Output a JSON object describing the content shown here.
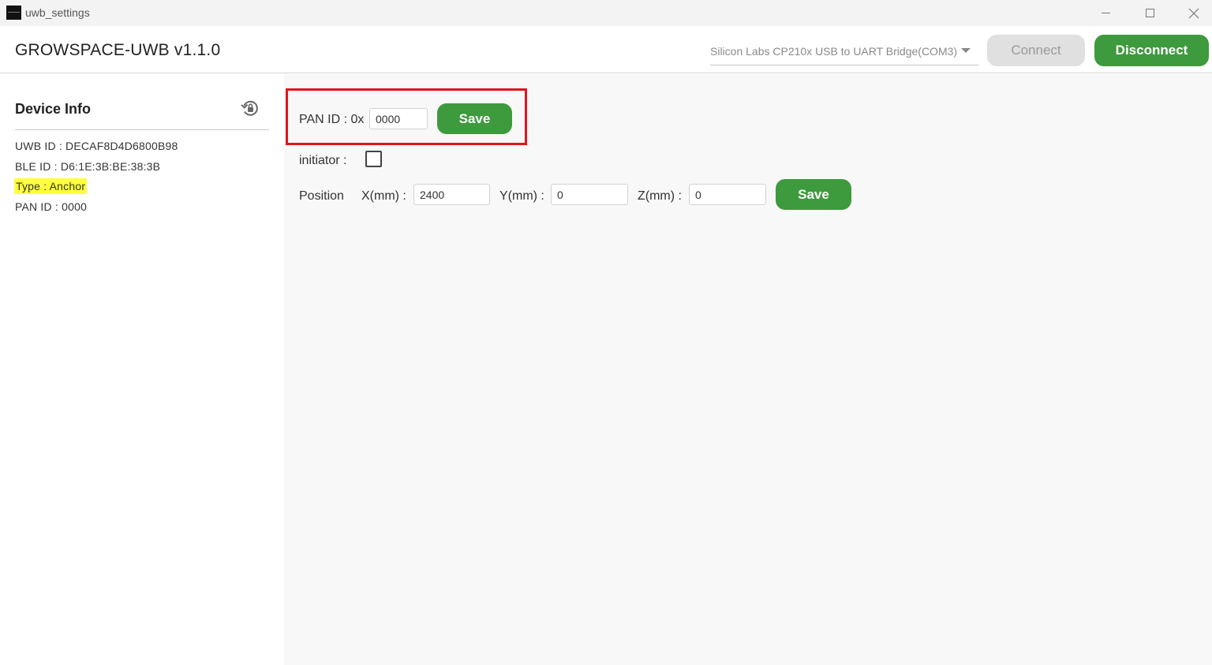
{
  "window": {
    "title": "uwb_settings",
    "controls": [
      "minimize",
      "maximize",
      "close"
    ]
  },
  "header": {
    "app_title": "GROWSPACE-UWB v1.1.0",
    "port_select": {
      "selected": "Silicon Labs CP210x USB to UART Bridge(COM3)"
    },
    "connect_label": "Connect",
    "disconnect_label": "Disconnect"
  },
  "sidebar": {
    "title": "Device Info",
    "uwb_id": "UWB ID : DECAF8D4D6800B98",
    "ble_id": "BLE ID : D6:1E:3B:BE:38:3B",
    "type": "Type : Anchor",
    "pan_id": "PAN ID : 0000"
  },
  "main": {
    "pan": {
      "label": "PAN ID : 0x",
      "value": "0000",
      "save_label": "Save"
    },
    "initiator": {
      "label": "initiator :",
      "checked": false
    },
    "position": {
      "label": "Position",
      "x_label": "X(mm) :",
      "x_value": "2400",
      "y_label": "Y(mm) :",
      "y_value": "0",
      "z_label": "Z(mm) :",
      "z_value": "0",
      "save_label": "Save"
    }
  },
  "colors": {
    "accent_green": "#3d9a3d",
    "highlight_yellow": "#ffff3c",
    "annotation_red": "#e0141e",
    "disabled_gray": "#e0e0e0"
  }
}
